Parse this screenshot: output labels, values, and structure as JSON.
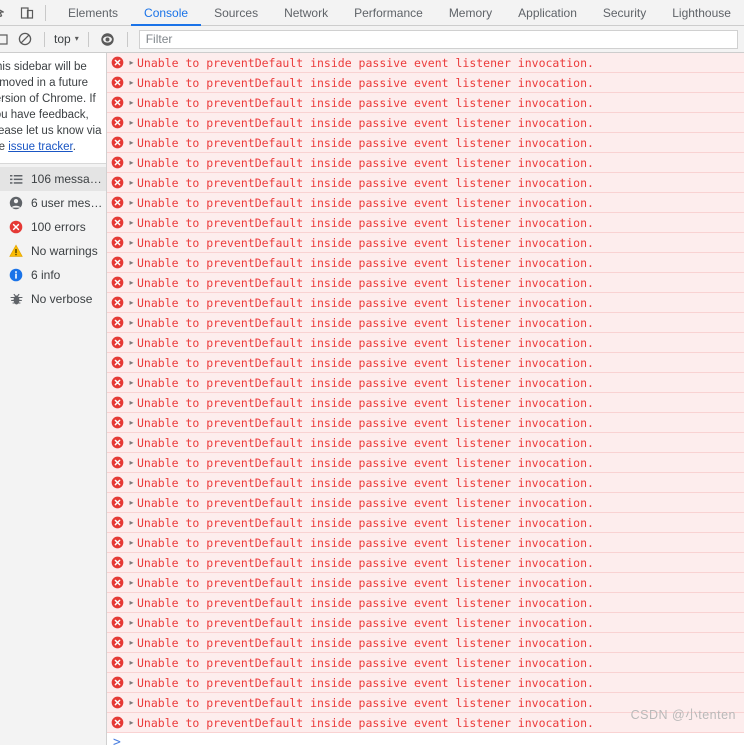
{
  "devtools": {
    "top_toolbar": {
      "inspect_icon": "inspect-element-icon",
      "device_toolbar_icon": "device-toolbar-icon"
    },
    "tabs": [
      {
        "label": "Elements",
        "active": false
      },
      {
        "label": "Console",
        "active": true
      },
      {
        "label": "Sources",
        "active": false
      },
      {
        "label": "Network",
        "active": false
      },
      {
        "label": "Performance",
        "active": false
      },
      {
        "label": "Memory",
        "active": false
      },
      {
        "label": "Application",
        "active": false
      },
      {
        "label": "Security",
        "active": false
      },
      {
        "label": "Lighthouse",
        "active": false
      }
    ],
    "active_tab": "Console",
    "accent_color": "#1a73e8"
  },
  "console_toolbar": {
    "sidebar_toggle_icon": "sidebar-toggle-icon",
    "clear_console_icon": "clear-console-icon",
    "context_selector": {
      "value": "top",
      "caret": "▾"
    },
    "live_expression_icon": "eye-icon",
    "filter": {
      "value": "",
      "placeholder": "Filter"
    }
  },
  "sidebar": {
    "notice": {
      "text": "This sidebar will be removed in a future version of Chrome. If you have feedback, please let us know via the ",
      "link_text": "issue tracker",
      "suffix": "."
    },
    "items": [
      {
        "label": "106 messag...",
        "icon": "list-icon",
        "selected": true
      },
      {
        "label": "6 user mess...",
        "icon": "user-icon",
        "selected": false
      },
      {
        "label": "100 errors",
        "icon": "error-icon",
        "selected": false
      },
      {
        "label": "No warnings",
        "icon": "warning-icon",
        "selected": false
      },
      {
        "label": "6 info",
        "icon": "info-icon",
        "selected": false
      },
      {
        "label": "No verbose",
        "icon": "bug-icon",
        "selected": false
      }
    ]
  },
  "console_output": {
    "message_text": "Unable to preventDefault inside passive event listener invocation.",
    "message_level": "error",
    "message_color": "#eb3b3b",
    "row_background": "#fdeded",
    "disclosure_glyph": "▸",
    "row_count": 34,
    "prompt_glyph": ">"
  },
  "watermark": {
    "text": "CSDN @小tenten"
  }
}
